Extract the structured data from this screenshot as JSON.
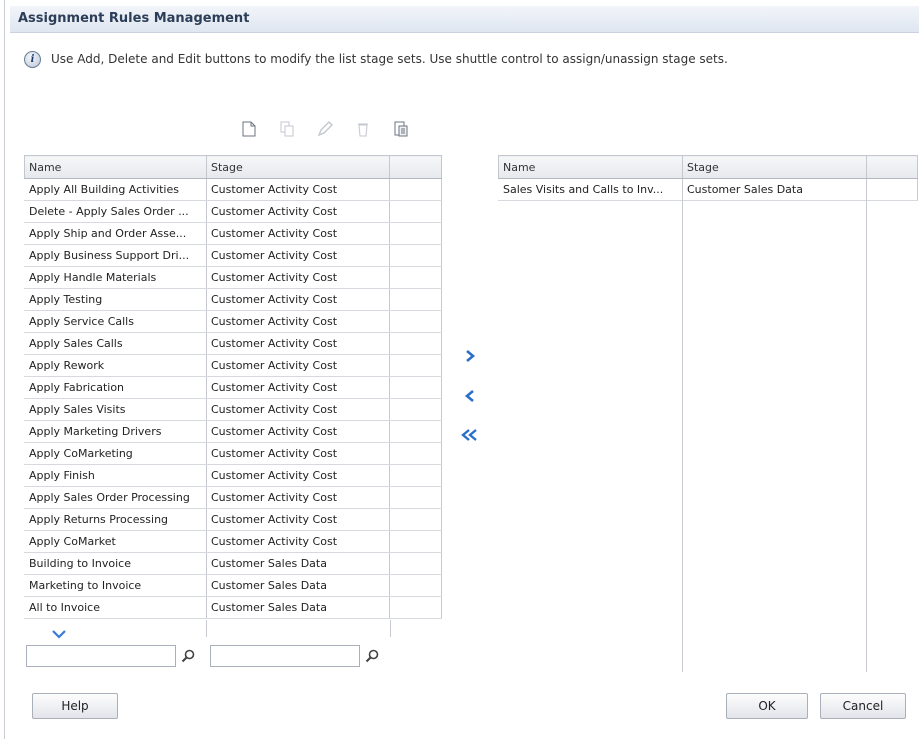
{
  "dialog": {
    "title": "Assignment Rules Management",
    "info_text": "Use Add, Delete and Edit buttons to modify the list stage sets. Use shuttle control to assign/unassign stage sets."
  },
  "toolbar": {
    "icons": [
      "new-document-icon",
      "copy-icon",
      "edit-pencil-icon",
      "delete-icon",
      "export-icon"
    ]
  },
  "available": {
    "headers": {
      "name": "Name",
      "stage": "Stage"
    },
    "rows": [
      {
        "name": "Apply All Building Activities",
        "stage": "Customer Activity Cost"
      },
      {
        "name": "Delete - Apply Sales Order ...",
        "stage": "Customer Activity Cost"
      },
      {
        "name": "Apply Ship and Order Asse...",
        "stage": "Customer Activity Cost"
      },
      {
        "name": "Apply Business Support Dri...",
        "stage": "Customer Activity Cost"
      },
      {
        "name": "Apply Handle Materials",
        "stage": "Customer Activity Cost"
      },
      {
        "name": "Apply Testing",
        "stage": "Customer Activity Cost"
      },
      {
        "name": "Apply Service Calls",
        "stage": "Customer Activity Cost"
      },
      {
        "name": "Apply Sales Calls",
        "stage": "Customer Activity Cost"
      },
      {
        "name": "Apply Rework",
        "stage": "Customer Activity Cost"
      },
      {
        "name": "Apply Fabrication",
        "stage": "Customer Activity Cost"
      },
      {
        "name": "Apply Sales Visits",
        "stage": "Customer Activity Cost"
      },
      {
        "name": "Apply Marketing Drivers",
        "stage": "Customer Activity Cost"
      },
      {
        "name": "Apply CoMarketing",
        "stage": "Customer Activity Cost"
      },
      {
        "name": "Apply Finish",
        "stage": "Customer Activity Cost"
      },
      {
        "name": "Apply Sales Order Processing",
        "stage": "Customer Activity Cost"
      },
      {
        "name": "Apply Returns Processing",
        "stage": "Customer Activity Cost"
      },
      {
        "name": "Apply CoMarket",
        "stage": "Customer Activity Cost"
      },
      {
        "name": "Building to Invoice",
        "stage": "Customer Sales Data"
      },
      {
        "name": "Marketing to Invoice",
        "stage": "Customer Sales Data"
      },
      {
        "name": "All to Invoice",
        "stage": "Customer Sales Data"
      }
    ],
    "filter_name_value": "",
    "filter_stage_value": ""
  },
  "selected": {
    "headers": {
      "name": "Name",
      "stage": "Stage"
    },
    "rows": [
      {
        "name": "Sales Visits and Calls to Inv...",
        "stage": "Customer Sales Data"
      }
    ]
  },
  "shuttle": {
    "icons": [
      "move-right-icon",
      "move-left-icon",
      "move-all-left-icon"
    ]
  },
  "buttons": {
    "help": "Help",
    "ok": "OK",
    "cancel": "Cancel"
  },
  "colors": {
    "title_text": "#2c3e58",
    "shuttle_blue": "#2a6fc9",
    "accent_blue": "#3a7bd5"
  }
}
